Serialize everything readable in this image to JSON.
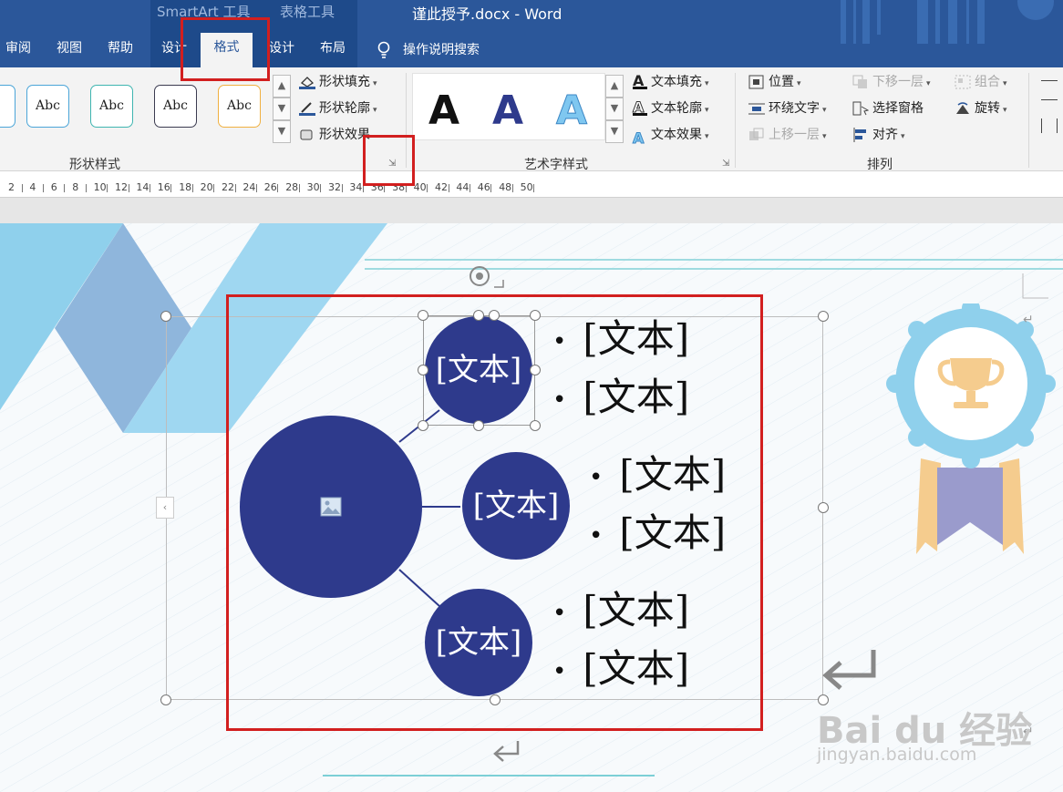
{
  "window": {
    "contextual": [
      "SmartArt 工具",
      "表格工具"
    ],
    "title": "谨此授予.docx  -  Word"
  },
  "tabs": {
    "review": "审阅",
    "view": "视图",
    "help": "帮助",
    "smartart_design": "设计",
    "smartart_format": "格式",
    "table_design": "设计",
    "table_layout": "布局",
    "search": "操作说明搜索"
  },
  "ribbon": {
    "shape_styles": {
      "label": "形状样式",
      "sample_label": "Abc",
      "fill": "形状填充",
      "outline": "形状轮廓",
      "effects": "形状效果"
    },
    "wordart_styles": {
      "label": "艺术字样式",
      "sample_letter": "A",
      "text_fill": "文本填充",
      "text_outline": "文本轮廓",
      "text_effects": "文本效果"
    },
    "arrange": {
      "label": "排列",
      "position": "位置",
      "wrap_text": "环绕文字",
      "bring_forward": "上移一层",
      "send_backward": "下移一层",
      "selection_pane": "选择窗格",
      "align": "对齐",
      "group": "组合",
      "rotate": "旋转"
    }
  },
  "ruler": {
    "numbers": [
      "2",
      "4",
      "6",
      "8",
      "10",
      "12",
      "14",
      "16",
      "18",
      "20",
      "22",
      "24",
      "26",
      "28",
      "30",
      "32",
      "34",
      "36",
      "38",
      "40",
      "42",
      "44",
      "46",
      "48",
      "50"
    ]
  },
  "smartart": {
    "node_text": "[文本]",
    "bullet_text": "[文本]"
  },
  "watermark": {
    "logo": "Bai du 经验",
    "url": "jingyan.baidu.com"
  },
  "colors": {
    "ribbon_blue": "#2b579a",
    "node_navy": "#2e3a8c",
    "highlight_red": "#d21f1f"
  }
}
